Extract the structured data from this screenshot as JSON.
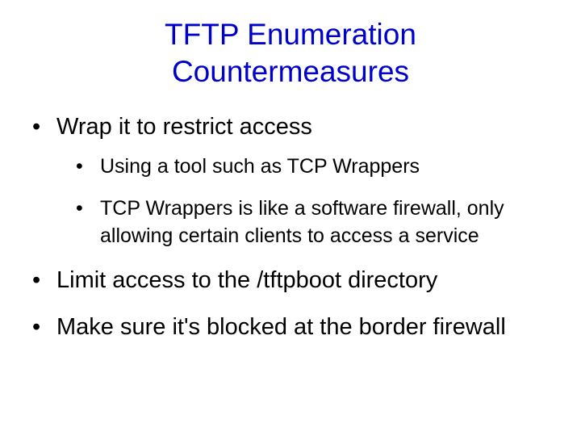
{
  "title_line1": "TFTP Enumeration",
  "title_line2": "Countermeasures",
  "bullets": {
    "b1": "Wrap it to restrict access",
    "b1_sub1": "Using a tool such as TCP Wrappers",
    "b1_sub2": "TCP Wrappers is like a software firewall, only allowing certain clients to access a service",
    "b2": "Limit access to the /tftpboot directory",
    "b3": "Make sure it's blocked at the border firewall"
  }
}
